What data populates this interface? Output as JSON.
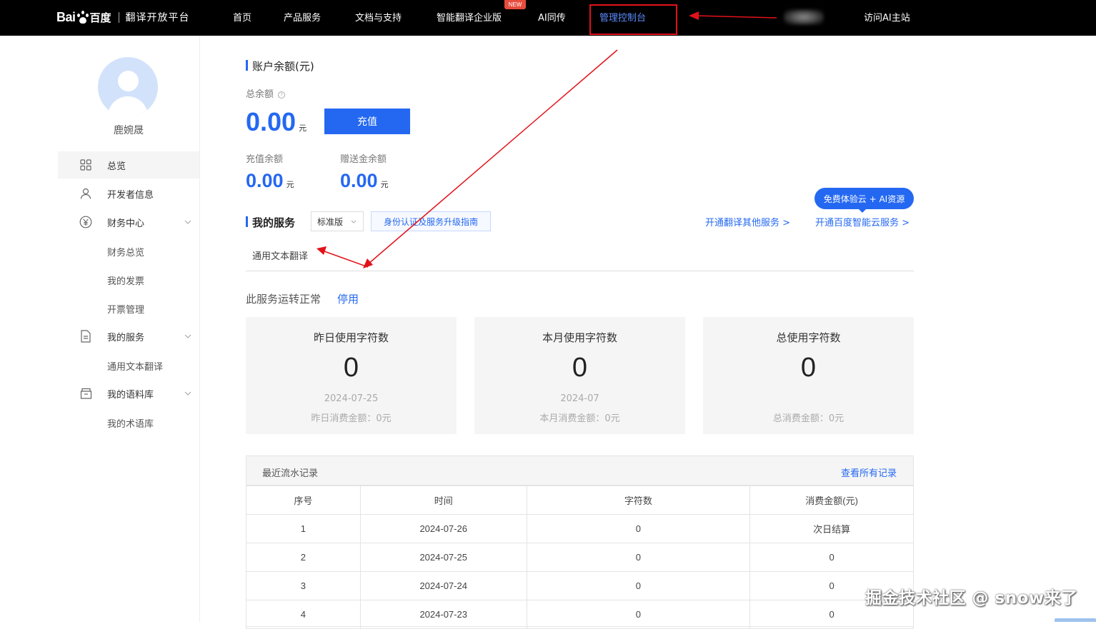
{
  "nav": {
    "logo_text": "Bai",
    "logo_cn": "百度",
    "platform_name": "翻译开放平台",
    "items": [
      "首页",
      "产品服务",
      "文档与支持",
      "智能翻译企业版",
      "AI同传",
      "管理控制台"
    ],
    "new_badge": "NEW",
    "visit_ai": "访问AI主站"
  },
  "sidebar": {
    "username": "鹿婉晟",
    "menu": [
      {
        "label": "总览"
      },
      {
        "label": "开发者信息"
      },
      {
        "label": "财务中心"
      },
      {
        "label": "我的服务"
      },
      {
        "label": "我的语料库"
      }
    ],
    "finance_sub": [
      "财务总览",
      "我的发票",
      "开票管理"
    ],
    "service_sub": [
      "通用文本翻译"
    ],
    "corpus_sub": [
      "我的术语库"
    ]
  },
  "balance": {
    "title": "账户余额(元)",
    "total_label": "总余额",
    "total_value": "0.00",
    "unit": "元",
    "recharge_button": "充值",
    "recharge_label": "充值余额",
    "recharge_value": "0.00",
    "gift_label": "赠送金余额",
    "gift_value": "0.00"
  },
  "services": {
    "title": "我的服务",
    "edition": "标准版",
    "guide_link": "身份认证及服务升级指南",
    "free_badge": "免费体验云 + AI资源",
    "open_other": "开通翻译其他服务 >",
    "open_cloud": "开通百度智能云服务 >",
    "tab": "通用文本翻译",
    "status": "此服务运转正常",
    "stop": "停用"
  },
  "stats": [
    {
      "title": "昨日使用字符数",
      "value": "0",
      "date": "2024-07-25",
      "fee": "昨日消费金额：0元"
    },
    {
      "title": "本月使用字符数",
      "value": "0",
      "date": "2024-07",
      "fee": "本月消费金额：0元"
    },
    {
      "title": "总使用字符数",
      "value": "0",
      "date": "",
      "fee": "总消费金额：0元"
    }
  ],
  "records": {
    "title": "最近流水记录",
    "view_all": "查看所有记录",
    "columns": [
      "序号",
      "时间",
      "字符数",
      "消费金额(元)"
    ],
    "rows": [
      [
        "1",
        "2024-07-26",
        "0",
        "次日结算"
      ],
      [
        "2",
        "2024-07-25",
        "0",
        "0"
      ],
      [
        "3",
        "2024-07-24",
        "0",
        "0"
      ],
      [
        "4",
        "2024-07-23",
        "0",
        "0"
      ]
    ]
  },
  "watermark": "掘金技术社区 @ snow来了",
  "colors": {
    "accent": "#2468f2",
    "annotation": "#e2121a",
    "topbar": "#000000"
  }
}
